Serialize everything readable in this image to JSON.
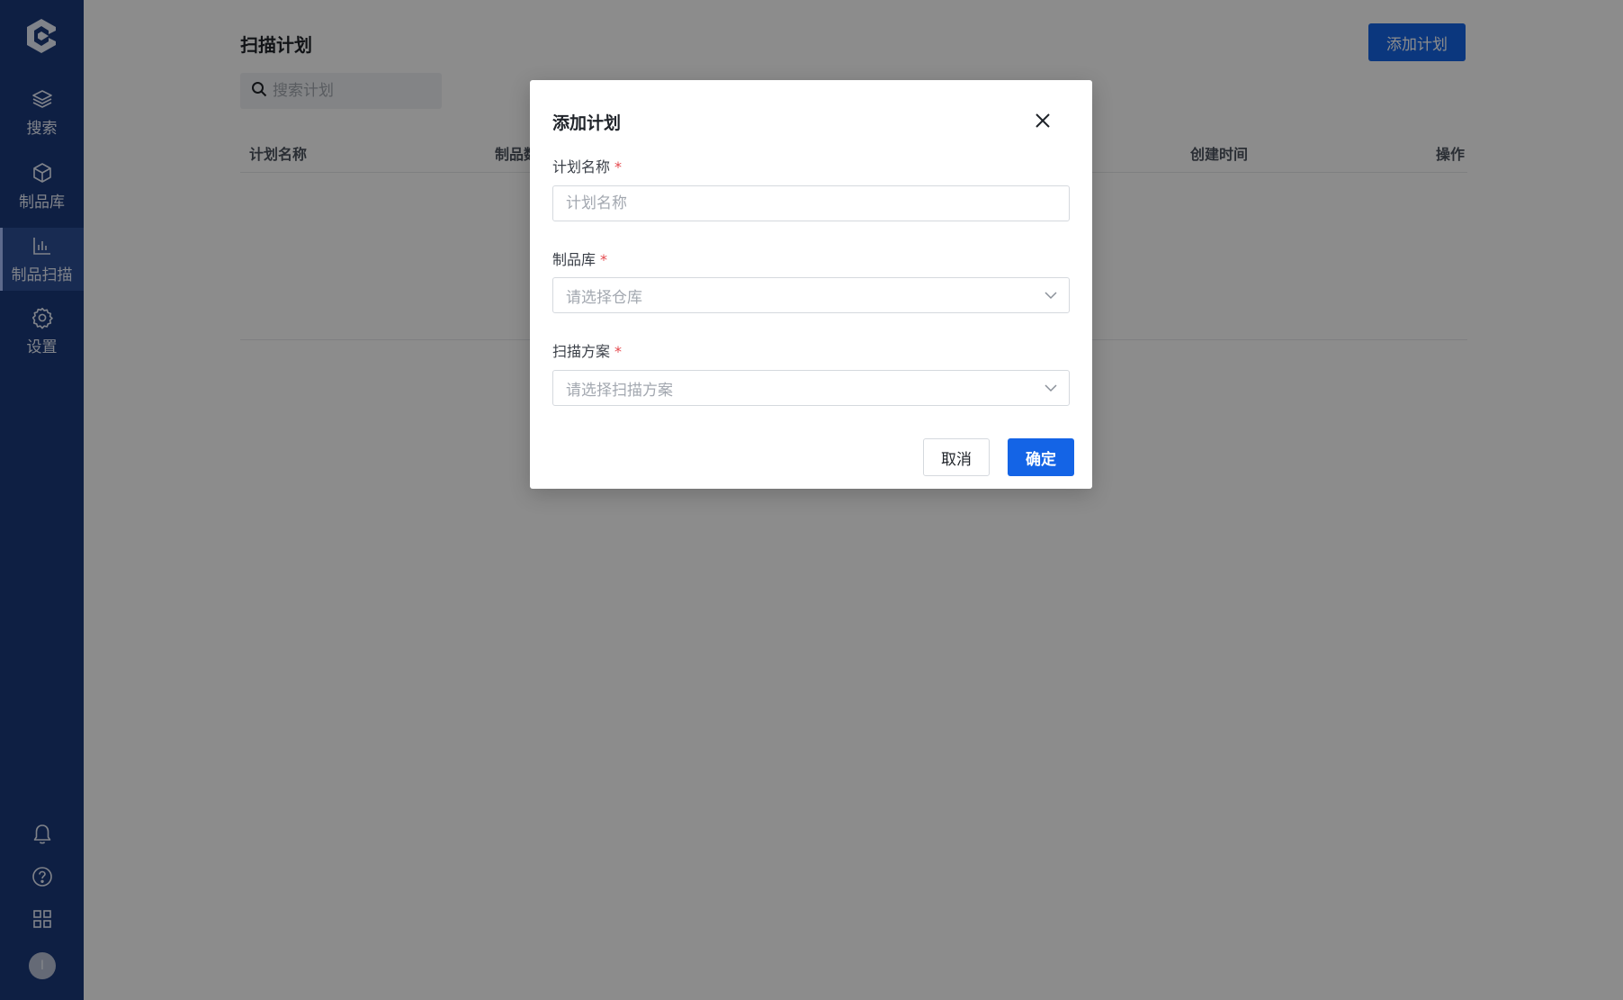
{
  "sidebar": {
    "logo": "c-logo-icon",
    "items": [
      {
        "label": "搜索",
        "icon": "layers-icon"
      },
      {
        "label": "制品库",
        "icon": "cube-icon"
      },
      {
        "label": "制品扫描",
        "icon": "bar-chart-icon",
        "active": true
      },
      {
        "label": "设置",
        "icon": "gear-icon"
      }
    ],
    "bottom_icons": [
      "bell-icon",
      "help-icon",
      "apps-grid-icon"
    ],
    "avatar_initial": "I"
  },
  "page": {
    "title": "扫描计划",
    "add_button": "添加计划",
    "search_placeholder": "搜索计划",
    "columns": [
      "计划名称",
      "制品数",
      "创建时间",
      "操作"
    ]
  },
  "modal": {
    "title": "添加计划",
    "fields": [
      {
        "label": "计划名称",
        "required": "*",
        "placeholder": "计划名称",
        "type": "text"
      },
      {
        "label": "制品库",
        "required": "*",
        "placeholder": "请选择仓库",
        "type": "select"
      },
      {
        "label": "扫描方案",
        "required": "*",
        "placeholder": "请选择扫描方案",
        "type": "select"
      }
    ],
    "cancel": "取消",
    "confirm": "确定"
  },
  "colors": {
    "sidebar_bg": "#1b3a7a",
    "primary": "#1464e6",
    "required": "#e5484d"
  }
}
